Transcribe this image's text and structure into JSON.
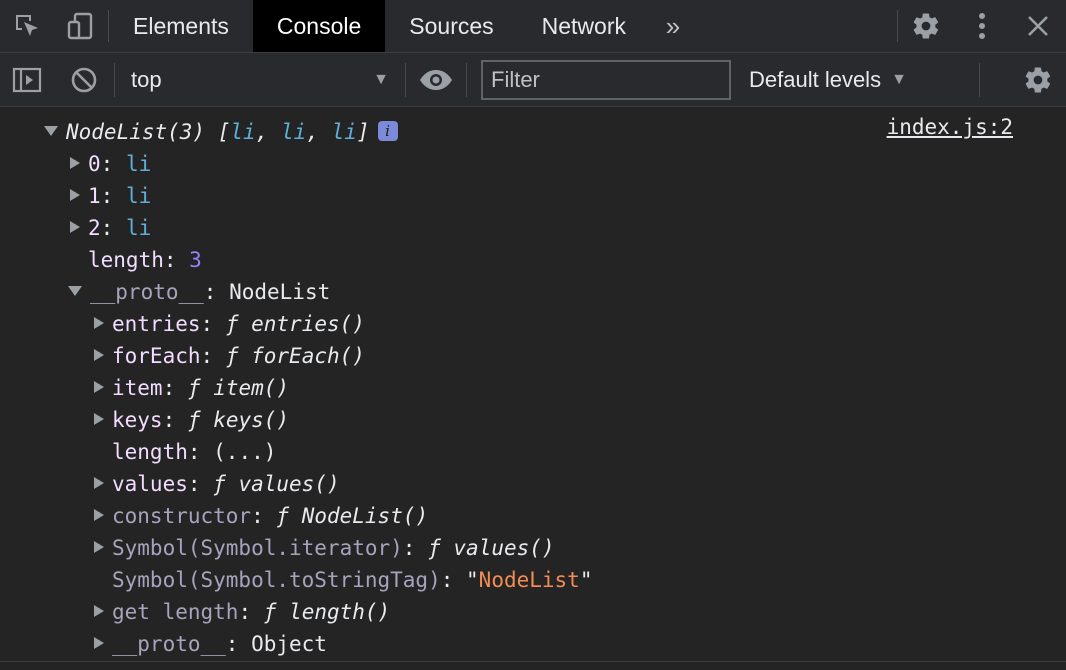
{
  "tabs": [
    "Elements",
    "Console",
    "Sources",
    "Network"
  ],
  "active_tab": "Console",
  "icons": {
    "inspect": "inspect-element-icon",
    "device": "device-toolbar-icon",
    "more_tabs": "double-chevron-right-icon",
    "settings": "gear-icon",
    "kebab": "vertical-dots-icon",
    "close": "close-icon",
    "sidebar": "sidebar-toggle-icon",
    "clear": "clear-console-icon",
    "eye": "eye-icon"
  },
  "toolbar": {
    "context": "top",
    "filter_placeholder": "Filter",
    "levels": "Default levels"
  },
  "console": {
    "header": {
      "label": "NodeList(3)",
      "items": "li",
      "source": "index.js:2"
    },
    "index_items": [
      {
        "key": "0",
        "value": "li"
      },
      {
        "key": "1",
        "value": "li"
      },
      {
        "key": "2",
        "value": "li"
      }
    ],
    "length": {
      "key": "length",
      "value": "3"
    },
    "proto": {
      "key": "__proto__",
      "value": "NodeList"
    },
    "proto_items": {
      "entries": {
        "key": "entries",
        "value": "entries()"
      },
      "forEach": {
        "key": "forEach",
        "value": "forEach()"
      },
      "item": {
        "key": "item",
        "value": "item()"
      },
      "keys": {
        "key": "keys",
        "value": "keys()"
      },
      "length": {
        "key": "length",
        "value": "(...)"
      },
      "values": {
        "key": "values",
        "value": "values()"
      },
      "constructor": {
        "key": "constructor",
        "value": "NodeList()"
      },
      "iterator": {
        "key": "Symbol(Symbol.iterator)",
        "value": "values()"
      },
      "tag": {
        "key": "Symbol(Symbol.toStringTag)",
        "value": "NodeList"
      },
      "get_length": {
        "key": "get length",
        "value": "length()"
      },
      "proto": {
        "key": "__proto__",
        "value": "Object"
      }
    },
    "f_symbol": "ƒ"
  }
}
